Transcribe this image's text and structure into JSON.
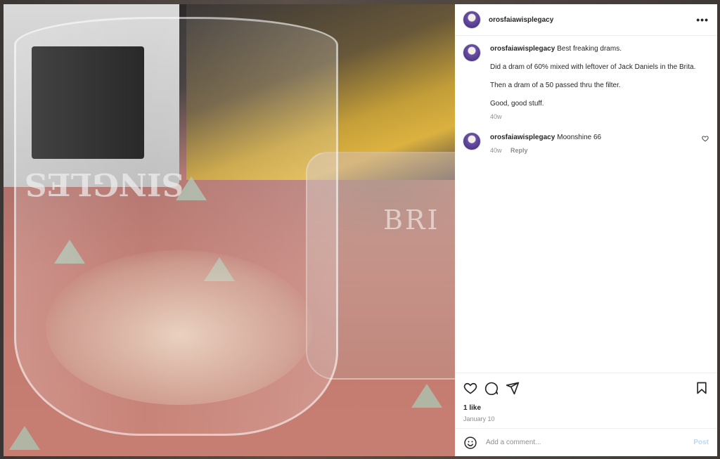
{
  "header": {
    "username": "orosfaiawisplegacy",
    "more_label": "•••"
  },
  "photo": {
    "glass_text": "SINGLES",
    "pitcher_text": "BRI"
  },
  "caption": {
    "username": "orosfaiawisplegacy",
    "text": "Best freaking drams.\n\nDid a dram of 60% mixed with leftover of Jack Daniels in the Brita.\n\nThen a dram of a 50 passed thru the filter.\n\nGood, good stuff.",
    "time": "40w"
  },
  "comments": [
    {
      "username": "orosfaiawisplegacy",
      "text": "Moonshine 66",
      "time": "40w",
      "reply_label": "Reply"
    }
  ],
  "footer": {
    "likes": "1 like",
    "date": "January 10"
  },
  "add_comment": {
    "placeholder": "Add a comment...",
    "post_label": "Post"
  },
  "icons": [
    "heart-icon",
    "comment-icon",
    "share-icon",
    "bookmark-icon",
    "emoji-icon",
    "more-icon"
  ]
}
